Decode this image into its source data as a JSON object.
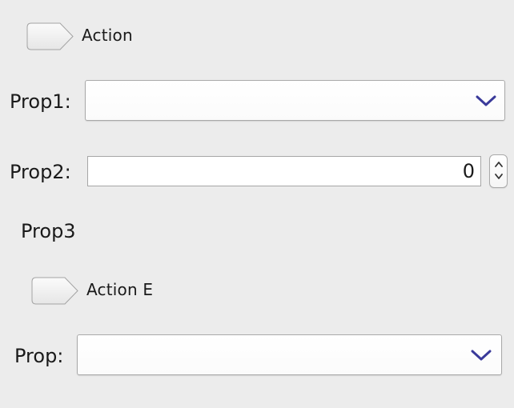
{
  "action_row": {
    "label": "Action"
  },
  "prop1": {
    "label": "Prop1:",
    "value": ""
  },
  "prop2": {
    "label": "Prop2:",
    "value": "0"
  },
  "prop3": {
    "label": "Prop3"
  },
  "action_e_row": {
    "label": "Action E"
  },
  "prop": {
    "label": "Prop:",
    "value": ""
  },
  "icons": {
    "combo_chevron": "chevron-down-icon",
    "spinner_up": "chevron-up-icon",
    "spinner_down": "chevron-down-icon"
  },
  "colors": {
    "background": "#ececec",
    "chevron": "#3a3a9a",
    "field_border": "#a9a9a9"
  }
}
